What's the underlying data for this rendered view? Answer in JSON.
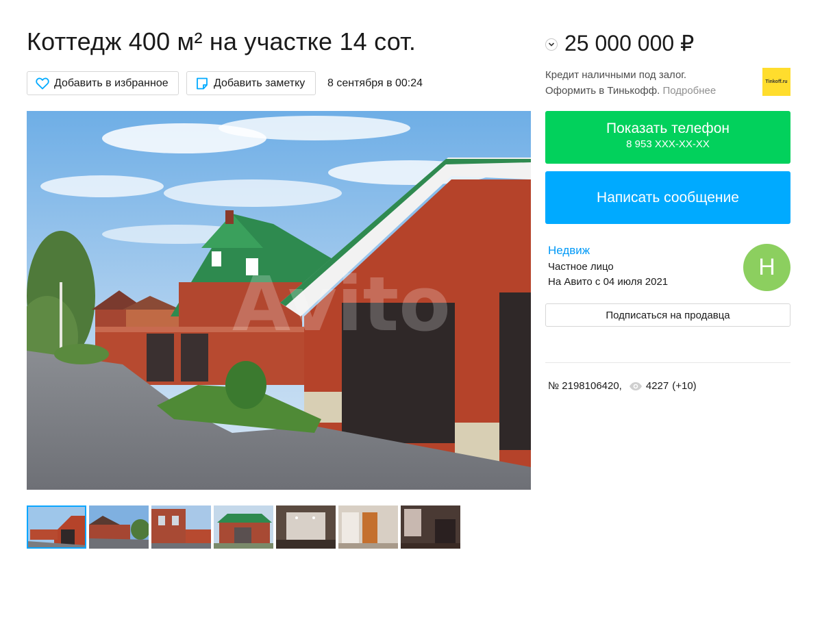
{
  "listing": {
    "title": "Коттедж 400 м² на участке 14 сот.",
    "date": "8 сентября в 00:24",
    "price": "25 000 000 ₽"
  },
  "actions": {
    "favorite_label": "Добавить в избранное",
    "note_label": "Добавить заметку"
  },
  "credit": {
    "line1": "Кредит наличными под залог.",
    "line2": "Оформить в Тинькофф.",
    "more": "Подробнее",
    "logo_text": "Tinkoff.ru"
  },
  "contact": {
    "phone_label": "Показать телефон",
    "phone_masked": "8 953 XXX-XX-XX",
    "message_label": "Написать сообщение"
  },
  "seller": {
    "name": "Недвиж",
    "type": "Частное лицо",
    "since": "На Авито с 04 июля 2021",
    "avatar_letter": "Н",
    "subscribe_label": "Подписаться на продавца"
  },
  "stats": {
    "number": "№ 2198106420,",
    "views": "4227",
    "views_delta": "(+10)"
  },
  "gallery": {
    "watermark": "Avito",
    "thumbnail_count": 7,
    "active_index": 0
  },
  "colors": {
    "green_button": "#02d15c",
    "blue_button": "#00aaff",
    "link": "#0099f7",
    "avatar": "#8ccf5f",
    "tinkoff_yellow": "#ffdd2d"
  }
}
